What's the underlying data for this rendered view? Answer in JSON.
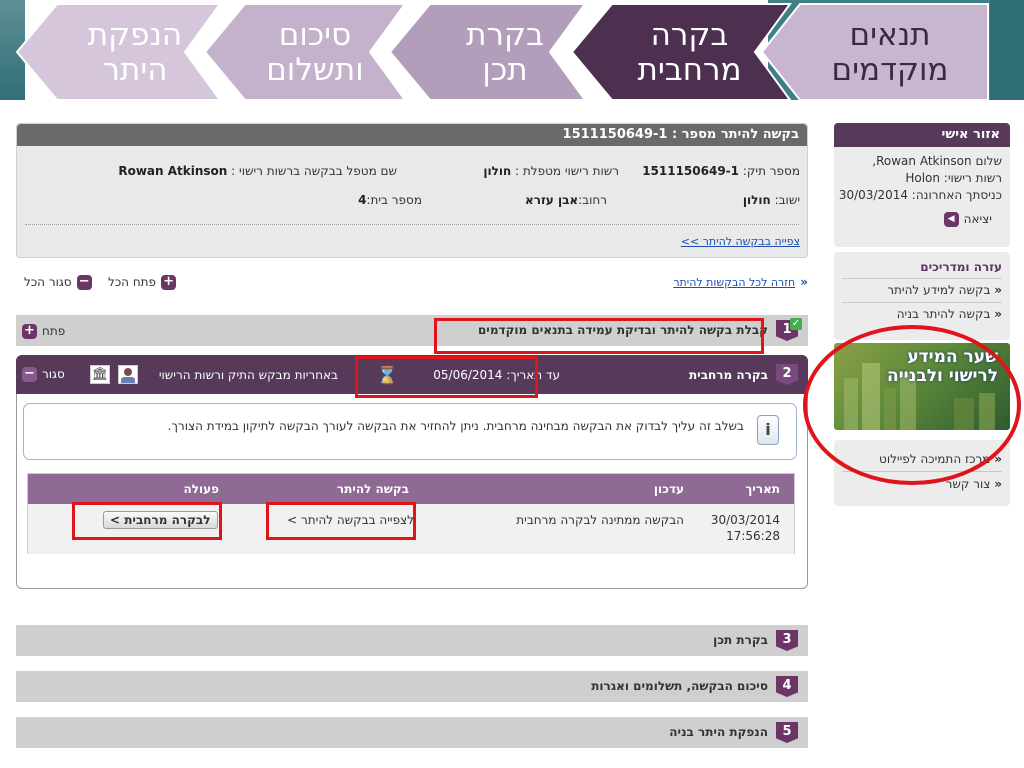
{
  "steps": [
    {
      "label": "תנאים\nמוקדמים",
      "state": "done"
    },
    {
      "label": "בקרה\nמרחבית",
      "state": "active"
    },
    {
      "label": "בקרת\nתכן",
      "state": "pending"
    },
    {
      "label": "סיכום\nותשלום",
      "state": "pending"
    },
    {
      "label": "הנפקת\nהיתר",
      "state": "pending"
    }
  ],
  "request": {
    "title": "בקשה להיתר מספר : 1511150649-1",
    "file_no_label": "מספר תיק:",
    "file_no": "1511150649-1",
    "authority_label": "רשות רישוי מטפלת :",
    "authority": "חולון",
    "handler_label": "שם מטפל בבקשה ברשות רישוי :",
    "handler": "Rowan Atkinson",
    "city_label": "ישוב:",
    "city": "חולון",
    "street_label": "רחוב:",
    "street": "אבן עזרא",
    "house_label": "מספר בית:",
    "house": "4",
    "view_link": "צפייה בבקשה להיתר >>"
  },
  "nav": {
    "back_link": "חזרה לכל הבקשות להיתר",
    "open_all": "פתח הכל",
    "close_all": "סגור הכל"
  },
  "stage1": {
    "num": "1",
    "title": "קבלת בקשה להיתר ובדיקת עמידה בתנאים מוקדמים",
    "action": "פתח"
  },
  "stage2": {
    "num": "2",
    "title": "בקרה מרחבית",
    "deadline": "עד תאריך: 05/06/2014",
    "responsibility": "באחריות מבקש התיק ורשות הרישוי",
    "action": "סגור",
    "notice": "בשלב זה עליך לבדוק את הבקשה מבחינה מרחבית. ניתן להחזיר את הבקשה לעורך הבקשה לתיקון במידת הצורך.",
    "table": {
      "headers": [
        "תאריך",
        "עדכון",
        "בקשה להיתר",
        "פעולה"
      ],
      "row": {
        "date": "30/03/2014",
        "time": "17:56:28",
        "update": "הבקשה ממתינה לבקרה מרחבית",
        "link": "לצפייה בבקשה להיתר >",
        "action_button": "לבקרה מרחבית >"
      }
    }
  },
  "stage3": {
    "num": "3",
    "title": "בקרת תכן"
  },
  "stage4": {
    "num": "4",
    "title": "סיכום הבקשה, תשלומים ואגרות"
  },
  "stage5": {
    "num": "5",
    "title": "הנפקת היתר בניה"
  },
  "sidebar": {
    "personal_title": "אזור אישי",
    "greeting": "שלום Rowan Atkinson,",
    "authority": "רשות רישוי: Holon",
    "last_login": "כניסתך האחרונה: 30/03/2014",
    "logout": "יציאה",
    "help_title": "עזרה ומדריכים",
    "help_items": [
      "בקשה למידע להיתר",
      "בקשה להיתר בניה"
    ],
    "promo_line1": "שער המידע",
    "promo_line2": "לרישוי ולבנייה",
    "support_items": [
      "מרכז התמיכה לפיילוט",
      "צור קשר"
    ]
  },
  "colors": {
    "accent": "#573a5a",
    "badge": "#6b3566",
    "highlight": "#e0151b",
    "link": "#1a4fb3"
  }
}
